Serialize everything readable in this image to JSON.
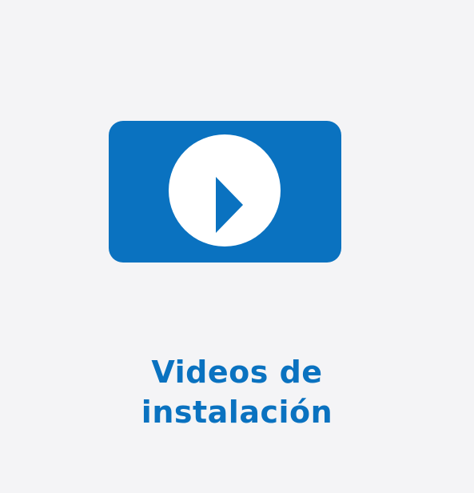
{
  "caption": {
    "line1": "Videos de",
    "line2": "instalación"
  },
  "icon": {
    "name": "play-icon"
  },
  "colors": {
    "accent": "#0a72c0",
    "background": "#f4f4f6",
    "icon_fill": "#ffffff"
  }
}
